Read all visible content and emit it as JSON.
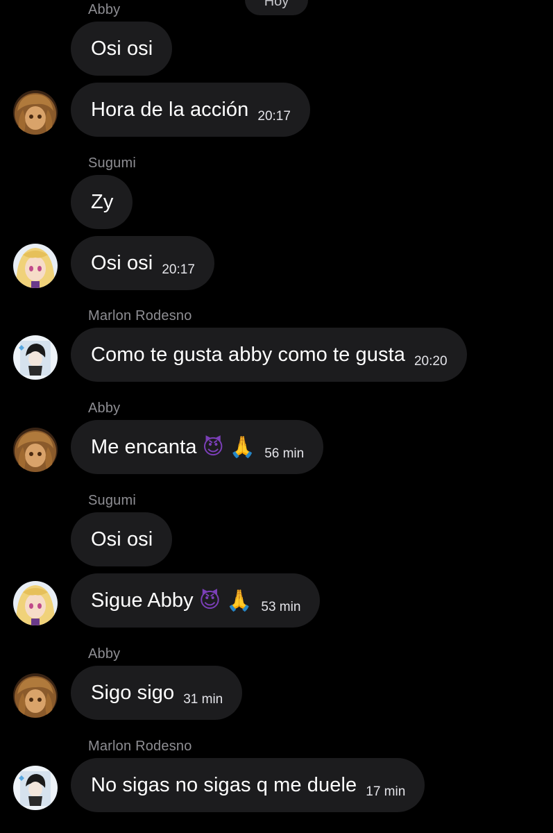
{
  "date_label": "Hoy",
  "messages": [
    {
      "sender": "Abby",
      "text": "Osi osi"
    },
    {
      "text": "Hora de la acción",
      "time": "20:17",
      "avatar": "abby-avatar"
    },
    {
      "sender": "Sugumi",
      "text": "Zy"
    },
    {
      "text": "Osi osi",
      "time": "20:17",
      "avatar": "sugumi-avatar"
    },
    {
      "sender": "Marlon Rodesno",
      "text": "Como te gusta abby como te gusta",
      "time": "20:20",
      "avatar": "marlon-avatar"
    },
    {
      "sender": "Abby",
      "text": "Me encanta",
      "emoji": [
        "😈",
        "🙏"
      ],
      "time": "56 min",
      "avatar": "abby-avatar"
    },
    {
      "sender": "Sugumi",
      "text": "Osi osi"
    },
    {
      "text": "Sigue Abby",
      "emoji": [
        "😈",
        "🙏"
      ],
      "time": "53 min",
      "avatar": "sugumi-avatar"
    },
    {
      "sender": "Abby",
      "text": "Sigo sigo",
      "time": "31 min",
      "avatar": "abby-avatar"
    },
    {
      "sender": "Marlon Rodesno",
      "text": "No sigas no sigas q me duele",
      "time": "17 min",
      "avatar": "marlon-avatar"
    }
  ],
  "colors": {
    "background": "#000000",
    "bubble": "#1c1c1e",
    "sender_name": "#8e8e93",
    "text": "#ffffff"
  }
}
